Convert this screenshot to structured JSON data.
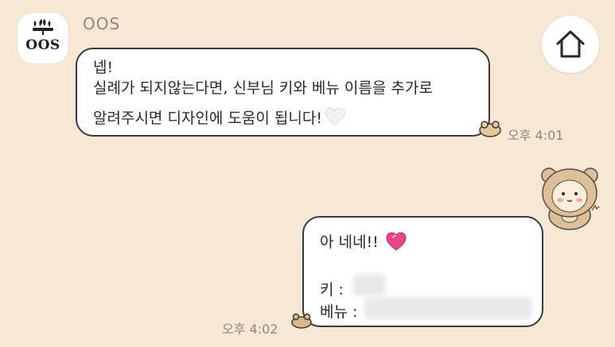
{
  "chat": {
    "sender_name": "OOS",
    "avatar_text": "OOS"
  },
  "incoming_message": {
    "line1": "넵!",
    "line2": "실례가 되지않는다면, 신부님 키와 베뉴 이름을 추가로",
    "line3": "알려주시면 디자인에 도움이 됩니다!",
    "emoji": "white-heart-icon",
    "time": "오후 4:01"
  },
  "outgoing_message": {
    "line1": "아 네네!!",
    "emoji": "pink-sparkling-heart-icon",
    "line2_label": "키 :",
    "line3_label": "베뉴 :",
    "time": "오후 4:02"
  },
  "colors": {
    "background": "#f7e8d6",
    "bubble": "#ffffff",
    "bubble_border": "#3a3a3a",
    "time_text": "#8d8780",
    "accent_pink": "#e8458b"
  }
}
